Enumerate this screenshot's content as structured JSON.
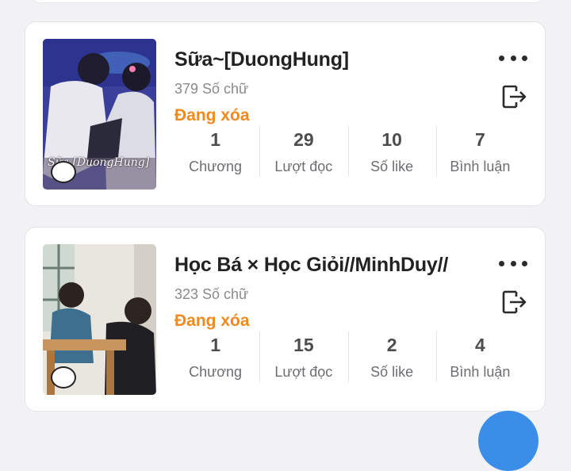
{
  "stories": [
    {
      "title": "Sữa~[DuongHung]",
      "word_count": "379 Số chữ",
      "status": "Đang xóa",
      "cover_text": "Sữa [DuongHung]",
      "stats": [
        {
          "value": "1",
          "label": "Chương"
        },
        {
          "value": "29",
          "label": "Lượt đọc"
        },
        {
          "value": "10",
          "label": "Số like"
        },
        {
          "value": "7",
          "label": "Bình luận"
        }
      ],
      "more_icon": "more-horizontal-icon",
      "action_icon": "exit-icon"
    },
    {
      "title": "Học Bá × Học Giỏi//MinhDuy//",
      "word_count": "323 Số chữ",
      "status": "Đang xóa",
      "stats": [
        {
          "value": "1",
          "label": "Chương"
        },
        {
          "value": "15",
          "label": "Lượt đọc"
        },
        {
          "value": "2",
          "label": "Số like"
        },
        {
          "value": "4",
          "label": "Bình luận"
        }
      ],
      "more_icon": "more-horizontal-icon",
      "action_icon": "exit-icon"
    }
  ],
  "colors": {
    "status": "#f08a1c",
    "background": "#f2f2f4",
    "fab": "#3a8ee8"
  }
}
